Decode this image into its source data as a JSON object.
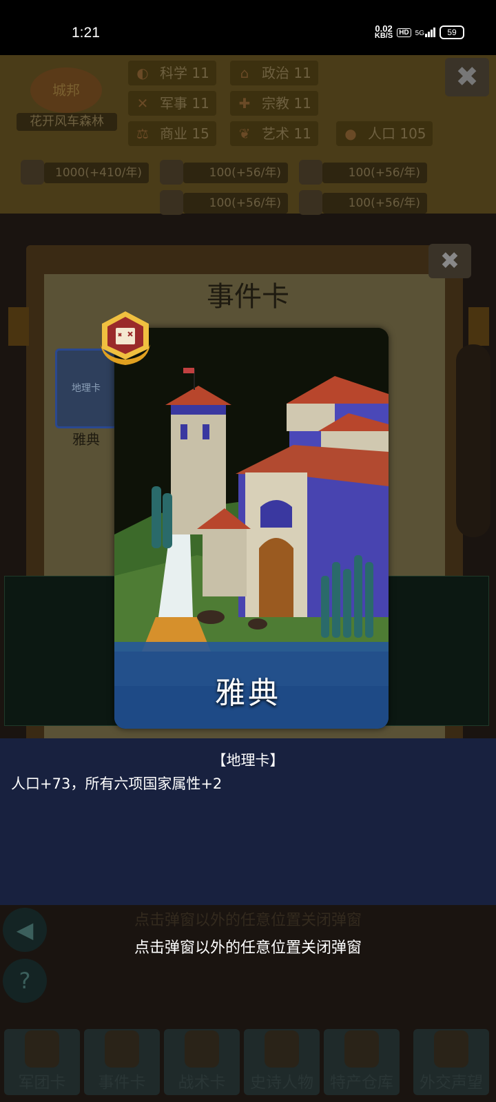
{
  "status_bar": {
    "time": "1:21",
    "net_speed": "0.02",
    "net_unit": "KB/S",
    "hd": "HD",
    "network": "5G",
    "battery": "59"
  },
  "header": {
    "emblem_label": "城邦",
    "city_name": "花开风车森林",
    "stats": [
      {
        "icon": "science-icon",
        "label": "科学",
        "value": "11"
      },
      {
        "icon": "politics-icon",
        "label": "政治",
        "value": "11"
      },
      {
        "icon": "military-icon",
        "label": "军事",
        "value": "11"
      },
      {
        "icon": "religion-icon",
        "label": "宗教",
        "value": "11"
      },
      {
        "icon": "commerce-icon",
        "label": "商业",
        "value": "15"
      },
      {
        "icon": "art-icon",
        "label": "艺术",
        "value": "11"
      },
      {
        "icon": "population-icon",
        "label": "人口",
        "value": "105"
      }
    ],
    "resources": [
      {
        "icon": "gold-icon",
        "value": "1000(+410/年)"
      },
      {
        "icon": "wood-icon",
        "value": "100(+56/年)"
      },
      {
        "icon": "stone-icon",
        "value": "100(+56/年)"
      },
      {
        "icon": "iron-icon",
        "value": "100(+56/年)"
      },
      {
        "icon": "meat-icon",
        "value": "100(+56/年)"
      }
    ]
  },
  "event_panel": {
    "title": "事件卡",
    "thumbnail_label": "地理卡",
    "thumbnail_caption": "雅典"
  },
  "card": {
    "name": "雅典",
    "type": "【地理卡】",
    "description": "人口+73，所有六项国家属性+2"
  },
  "hint_dim": "点击弹窗以外的任意位置关闭弹窗",
  "hint": "点击弹窗以外的任意位置关闭弹窗",
  "bottom_nav": [
    {
      "label": "军团卡"
    },
    {
      "label": "事件卡"
    },
    {
      "label": "战术卡"
    },
    {
      "label": "史诗人物"
    },
    {
      "label": "特产仓库"
    },
    {
      "label": "外交声望"
    }
  ]
}
